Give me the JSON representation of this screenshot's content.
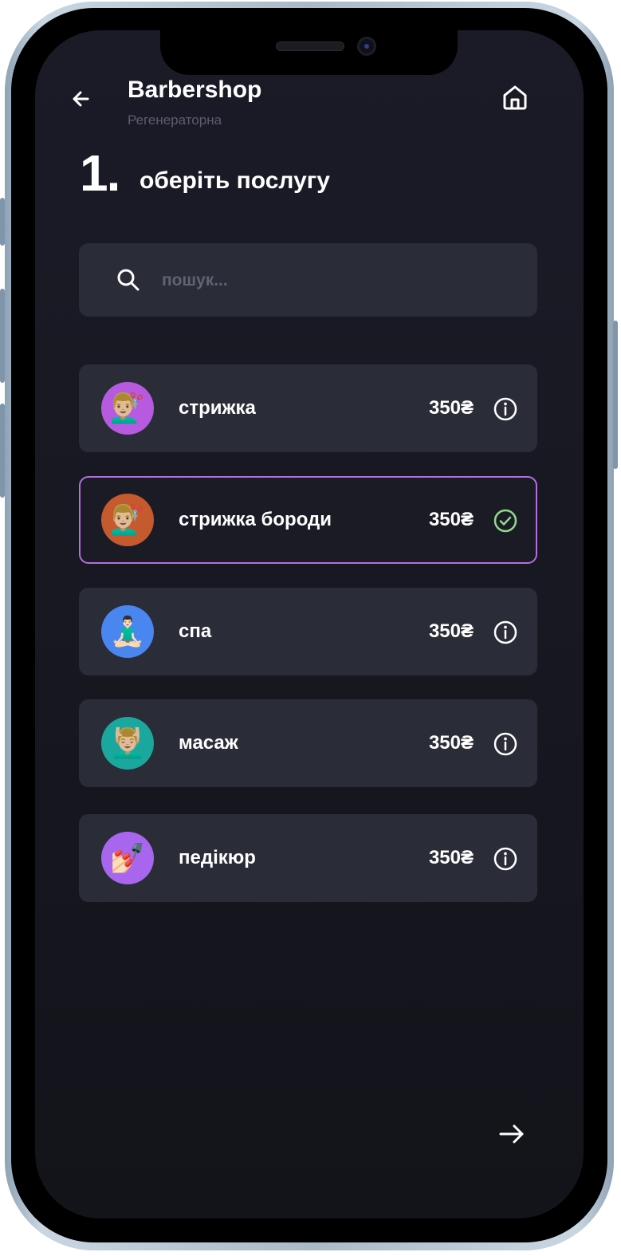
{
  "header": {
    "title": "Barbershop",
    "subtitle": "Регенераторна",
    "back_icon": "arrow-left-icon",
    "home_icon": "home-icon"
  },
  "step": {
    "number": "1.",
    "title": "оберіть послугу"
  },
  "search": {
    "placeholder": "пошук...",
    "value": "",
    "icon": "search-icon"
  },
  "services": [
    {
      "name": "стрижка",
      "price": "350₴",
      "emoji": "💇🏼‍♂️",
      "avatar_color": "#b65be0",
      "selected": false,
      "status_icon": "info-icon"
    },
    {
      "name": "стрижка бороди",
      "price": "350₴",
      "emoji": "💇🏼‍♂️",
      "avatar_color": "#c45a2e",
      "selected": true,
      "status_icon": "check-circle-icon"
    },
    {
      "name": "спа",
      "price": "350₴",
      "emoji": "🧘🏻‍♂️",
      "avatar_color": "#4a86f0",
      "selected": false,
      "status_icon": "info-icon"
    },
    {
      "name": "масаж",
      "price": "350₴",
      "emoji": "💆🏼‍♂️",
      "avatar_color": "#1aa89e",
      "selected": false,
      "status_icon": "info-icon"
    },
    {
      "name": "педікюр",
      "price": "350₴",
      "emoji": "💅🏻",
      "avatar_color": "#a866ef",
      "selected": false,
      "status_icon": "info-icon"
    }
  ],
  "footer": {
    "next_icon": "arrow-right-icon"
  },
  "colors": {
    "background": "#181822",
    "card": "#2a2c38",
    "selected_border": "#b46ee0",
    "check": "#8fd98a",
    "muted_text": "#5c5c6c"
  }
}
